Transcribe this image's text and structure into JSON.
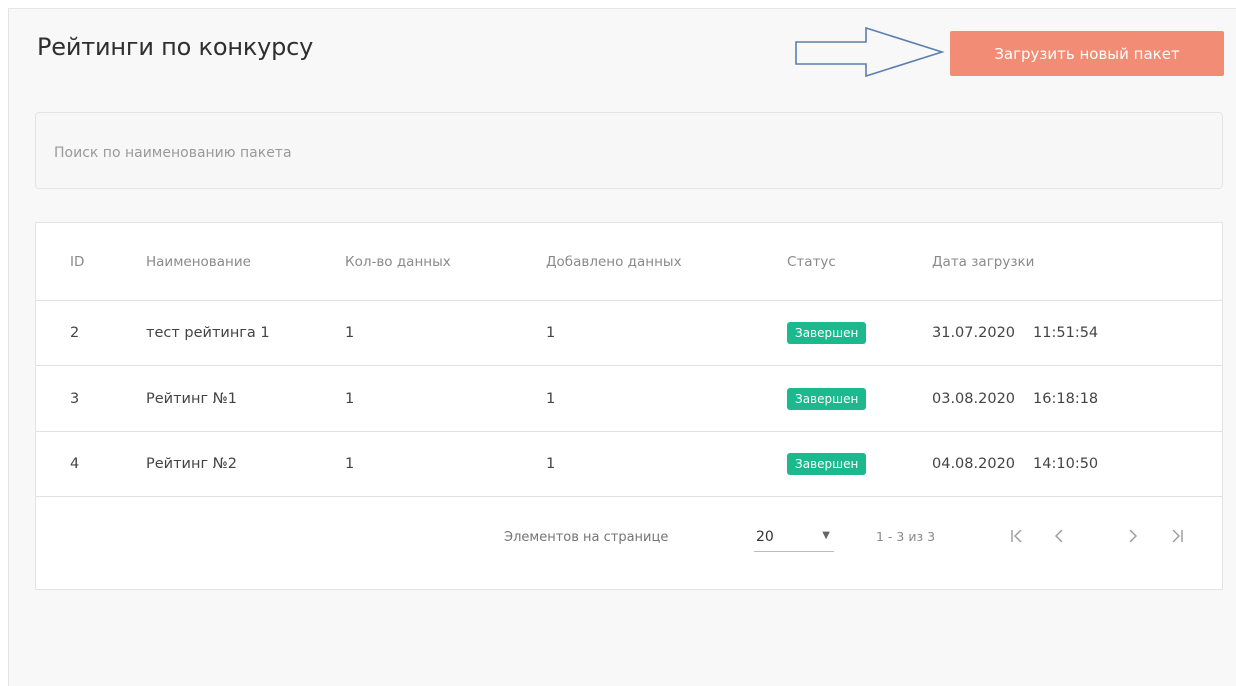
{
  "page": {
    "title": "Рейтинги по конкурсу"
  },
  "toolbar": {
    "upload_label": "Загрузить новый пакет"
  },
  "search": {
    "placeholder": "Поиск по наименованию пакета",
    "value": ""
  },
  "table": {
    "columns": [
      "ID",
      "Наименование",
      "Кол-во данных",
      "Добавлено данных",
      "Статус",
      "Дата загрузки"
    ],
    "rows": [
      {
        "id": "2",
        "name": "тест рейтинга 1",
        "qty": "1",
        "added": "1",
        "status": "Завершен",
        "date": "31.07.2020",
        "time": "11:51:54"
      },
      {
        "id": "3",
        "name": "Рейтинг №1",
        "qty": "1",
        "added": "1",
        "status": "Завершен",
        "date": "03.08.2020",
        "time": "16:18:18"
      },
      {
        "id": "4",
        "name": "Рейтинг №2",
        "qty": "1",
        "added": "1",
        "status": "Завершен",
        "date": "04.08.2020",
        "time": "14:10:50"
      }
    ]
  },
  "pagination": {
    "per_page_label": "Элементов на странице",
    "per_page_value": "20",
    "range_label": "1 - 3 из 3"
  },
  "colors": {
    "accent": "#f28c74",
    "status_done": "#1cb98e"
  },
  "icons": {
    "arrow": "arrow-right-outline-icon",
    "dropdown": "chevron-down-icon",
    "first": "first-page-icon",
    "prev": "chevron-left-icon",
    "next": "chevron-right-icon",
    "last": "last-page-icon"
  }
}
